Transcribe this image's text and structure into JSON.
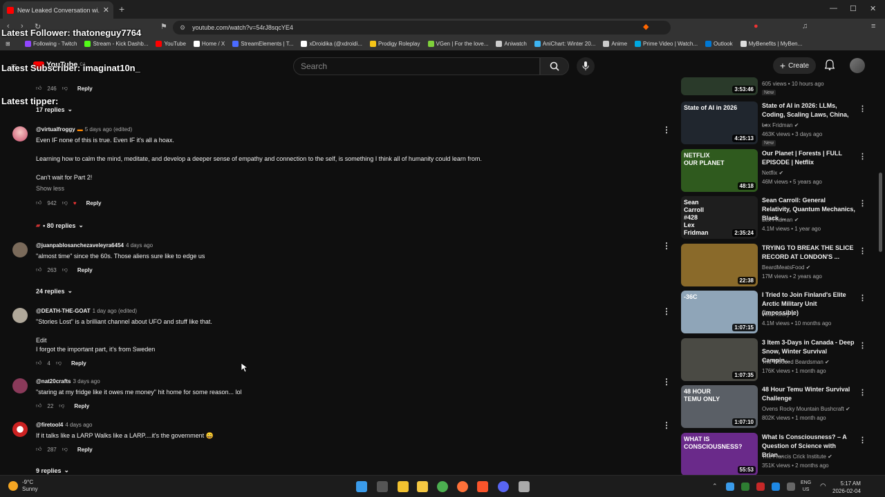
{
  "browser": {
    "tab_title": "New Leaked Conversation wi...",
    "url": "youtube.com/watch?v=54rJ8sqcYE4",
    "bookmarks": [
      {
        "label": "Following - Twitch",
        "color": "#9146ff"
      },
      {
        "label": "Stream - Kick Dashb...",
        "color": "#53fc18"
      },
      {
        "label": "YouTube",
        "color": "#ff0000"
      },
      {
        "label": "Home / X",
        "color": "#ffffff"
      },
      {
        "label": "StreamElements | T...",
        "color": "#4b6bff"
      },
      {
        "label": "xDroidika (@xdroidi...",
        "color": "#ffffff"
      },
      {
        "label": "Prodigy Roleplay",
        "color": "#f5c518"
      },
      {
        "label": "VGen | For the love...",
        "color": "#7fd13b"
      },
      {
        "label": "Aniwatch",
        "color": "#cccccc"
      },
      {
        "label": "AniChart: Winter 20...",
        "color": "#3db4f2"
      },
      {
        "label": "Anime",
        "color": "#cccccc"
      },
      {
        "label": "Prime Video | Watch...",
        "color": "#00a8e1"
      },
      {
        "label": "Outlook",
        "color": "#0078d4"
      },
      {
        "label": "MyBenefits | MyBen...",
        "color": "#dddddd"
      }
    ]
  },
  "overlay": {
    "follower": "Latest Follower: thatoneguy7764",
    "subscriber": "Latest Subscriber: imaginat10n_",
    "tipper": "Latest tipper:"
  },
  "youtube": {
    "logo": "YouTube",
    "country": "CA",
    "search_placeholder": "Search",
    "create_label": "Create"
  },
  "comments": {
    "top_likes": "246",
    "top_reply": "Reply",
    "top_replies": "17 replies",
    "items": [
      {
        "author": "@virtualfroggy",
        "meta": "5 days ago (edited)",
        "lines": [
          "Even IF none of this is true. Even IF it's all a hoax.",
          "Learning how to calm the mind, meditate, and develop a deeper sense of empathy and connection to the self, is something I think all of humanity could learn from.",
          "Can't wait for Part 2!"
        ],
        "show_less": "Show less",
        "likes": "942",
        "reply": "Reply",
        "replies": "• 80 replies"
      },
      {
        "author": "@juanpablosanchezaveleyra6454",
        "meta": "4 days ago",
        "lines": [
          "\"almost time\" since the 60s. Those aliens sure like to edge us"
        ],
        "likes": "263",
        "reply": "Reply",
        "replies": "24 replies"
      },
      {
        "author": "@DEATH-THE-GOAT",
        "meta": "1 day ago (edited)",
        "lines": [
          "\"Stories Lost\" is a brilliant channel about UFO and stuff like that.",
          "Edit",
          "I forgot the important part, it's from Sweden"
        ],
        "likes": "4",
        "reply": "Reply"
      },
      {
        "author": "@nat20crafts",
        "meta": "3 days ago",
        "lines": [
          "\"staring at my fridge like it owes me money\" hit home for some reason... lol"
        ],
        "likes": "22",
        "reply": "Reply"
      },
      {
        "author": "@firetool4",
        "meta": "4 days ago",
        "lines": [
          "If it talks like a LARP Walks like a LARP....it's the government 😄"
        ],
        "likes": "287",
        "reply": "Reply",
        "replies": "9 replies"
      }
    ]
  },
  "sidebar": {
    "partial_meta": "605 views • 10 hours ago",
    "partial_new": "New",
    "partial_duration": "3:53:46",
    "videos": [
      {
        "title": "State of AI in 2026: LLMs, Coding, Scaling Laws, China, ...",
        "channel": "Lex Fridman",
        "meta": "463K views • 3 days ago",
        "badge": "New",
        "duration": "4:25:13",
        "thumb_text": "State of AI in 2026",
        "bg": "#20262e"
      },
      {
        "title": "Our Planet | Forests | FULL EPISODE | Netflix",
        "channel": "Netflix",
        "meta": "46M views • 5 years ago",
        "duration": "48:18",
        "thumb_text": "NETFLIX\nOUR PLANET",
        "bg": "#2f5a1e"
      },
      {
        "title": "Sean Carroll: General Relativity, Quantum Mechanics, Black ...",
        "channel": "Lex Fridman",
        "meta": "4.1M views • 1 year ago",
        "duration": "2:35:24",
        "thumb_text": "Sean\nCarroll\n#428\nLex\nFridman",
        "bg": "#1e1e1e"
      },
      {
        "title": "TRYING TO BREAK THE SLICE RECORD AT LONDON'S ...",
        "channel": "BeardMeatsFood",
        "meta": "17M views • 2 years ago",
        "duration": "22:38",
        "thumb_text": "",
        "bg": "#8a6a2a"
      },
      {
        "title": "I Tried to Join Finland's Elite Arctic Military Unit (impossible)",
        "channel": "Yes Theory",
        "meta": "4.1M views • 10 months ago",
        "duration": "1:07:15",
        "thumb_text": "-36C",
        "bg": "#8fa5b8"
      },
      {
        "title": "3 Item 3-Days in Canada - Deep Snow, Winter Survival Campin...",
        "channel": "The Wooded Beardsman",
        "meta": "176K views • 1 month ago",
        "duration": "1:07:35",
        "thumb_text": "",
        "bg": "#4a4a44"
      },
      {
        "title": "48 Hour Temu Winter Survival Challenge",
        "channel": "Ovens Rocky Mountain Bushcraft",
        "meta": "802K views • 1 month ago",
        "duration": "1:07:10",
        "thumb_text": "48 HOUR\nTEMU ONLY",
        "bg": "#5a5f66"
      },
      {
        "title": "What Is Consciousness? – A Question of Science with Brian...",
        "channel": "The Francis Crick Institute",
        "meta": "351K views • 2 months ago",
        "duration": "55:53",
        "thumb_text": "WHAT IS\nCONSCIOUSNESS?",
        "bg": "#6a2a8a"
      }
    ]
  },
  "taskbar": {
    "temp": "-9°C",
    "weather": "Sunny",
    "lang1": "ENG",
    "lang2": "US",
    "time": "5:17 AM",
    "date": "2026-02-04"
  }
}
